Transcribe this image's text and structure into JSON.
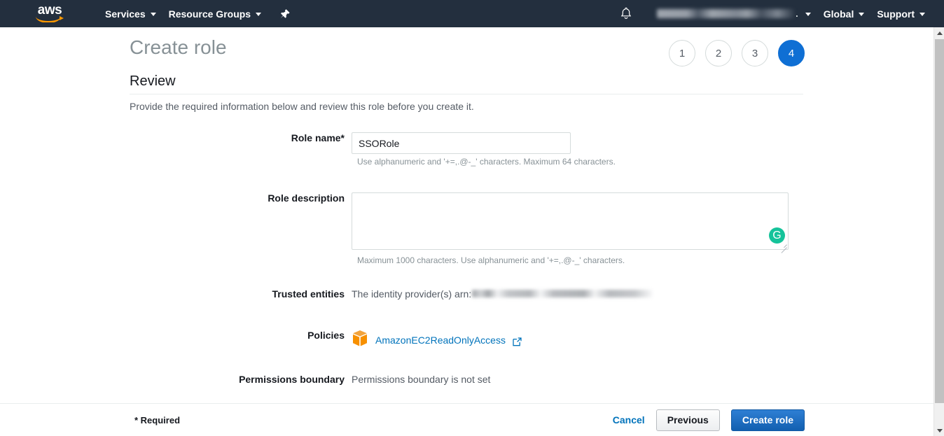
{
  "topnav": {
    "logo_text": "aws",
    "logo_name": "aws-logo",
    "services_label": "Services",
    "resource_groups_label": "Resource Groups",
    "pin_icon": "pin-icon",
    "bell_icon": "bell-icon",
    "account_label": "",
    "region_label": "Global",
    "support_label": "Support"
  },
  "header": {
    "page_title": "Create role",
    "section_title": "Review",
    "section_description": "Provide the required information below and review this role before you create it.",
    "steps": [
      "1",
      "2",
      "3",
      "4"
    ],
    "active_step": "4"
  },
  "form": {
    "role_name": {
      "label": "Role name*",
      "value": "SSORole",
      "placeholder": "",
      "hint": "Use alphanumeric and '+=,.@-_' characters. Maximum 64 characters."
    },
    "role_description": {
      "label": "Role description",
      "value": "",
      "placeholder": "",
      "hint": "Maximum 1000 characters. Use alphanumeric and '+=,.@-_' characters.",
      "grammarly_badge": "G"
    },
    "trusted_entities": {
      "label": "Trusted entities",
      "value": "The identity provider(s) arn:"
    },
    "policies": {
      "label": "Policies",
      "policy_icon": "policy-box-icon",
      "items": [
        {
          "name": "AmazonEC2ReadOnlyAccess",
          "external_link_icon": "external-link-icon"
        }
      ]
    },
    "permissions_boundary": {
      "label": "Permissions boundary",
      "value": "Permissions boundary is not set"
    }
  },
  "footer": {
    "required_note": "* Required",
    "cancel_label": "Cancel",
    "previous_label": "Previous",
    "create_label": "Create role"
  },
  "colors": {
    "nav_background": "#232f3e",
    "accent_orange": "#ff9900",
    "link_blue": "#0073bb",
    "primary_button": "#125fb0",
    "step_active": "#0f6fd4",
    "grammarly_green": "#15c39a"
  }
}
